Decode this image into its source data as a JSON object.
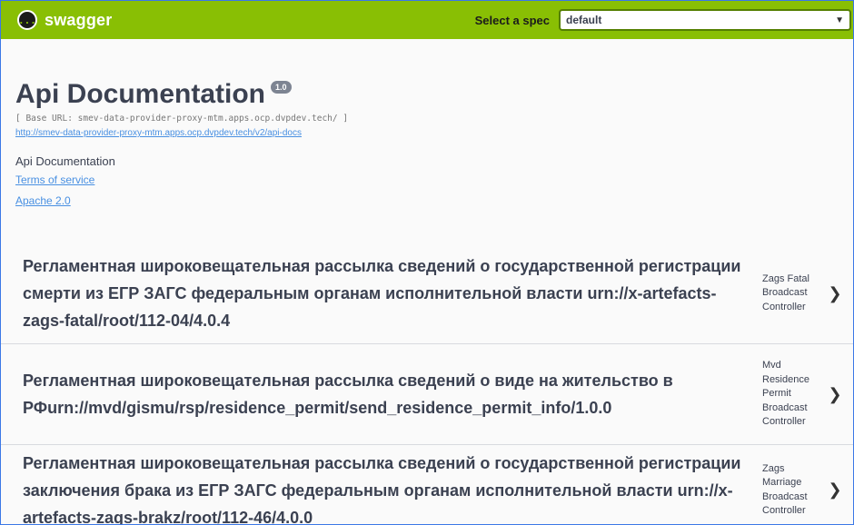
{
  "topbar": {
    "logo_glyph": "{...}",
    "logo_text": "swagger",
    "spec_label": "Select a spec",
    "spec_selected": "default"
  },
  "info": {
    "title": "Api Documentation",
    "version": "1.0",
    "base_url": "[ Base URL: smev-data-provider-proxy-mtm.apps.ocp.dvpdev.tech/ ]",
    "api_docs_link": "http://smev-data-provider-proxy-mtm.apps.ocp.dvpdev.tech/v2/api-docs",
    "description": "Api Documentation",
    "terms_link": "Terms of service",
    "license_link": "Apache 2.0"
  },
  "tags": [
    {
      "title": "Регламентная широковещательная рассылка сведений о государственной регистрации смерти из ЕГР ЗАГС федеральным органам исполнительной власти urn://x-artefacts-zags-fatal/root/112-04/4.0.4",
      "desc": "Zags Fatal Broadcast Controller"
    },
    {
      "title": "Регламентная широковещательная рассылка сведений о виде на жительство в РФurn://mvd/gismu/rsp/residence_permit/send_residence_permit_info/1.0.0",
      "desc": "Mvd Residence Permit Broadcast Controller"
    },
    {
      "title": "Регламентная широковещательная рассылка сведений о государственной регистрации заключения брака из ЕГР ЗАГС федеральным органам исполнительной власти urn://x-artefacts-zags-brakz/root/112-46/4.0.0",
      "desc": "Zags Marriage Broadcast Controller"
    }
  ],
  "colors": {
    "topbar": "#89bf04",
    "link": "#4990e2",
    "text": "#3b4151",
    "frame_border": "#3b78e7"
  }
}
